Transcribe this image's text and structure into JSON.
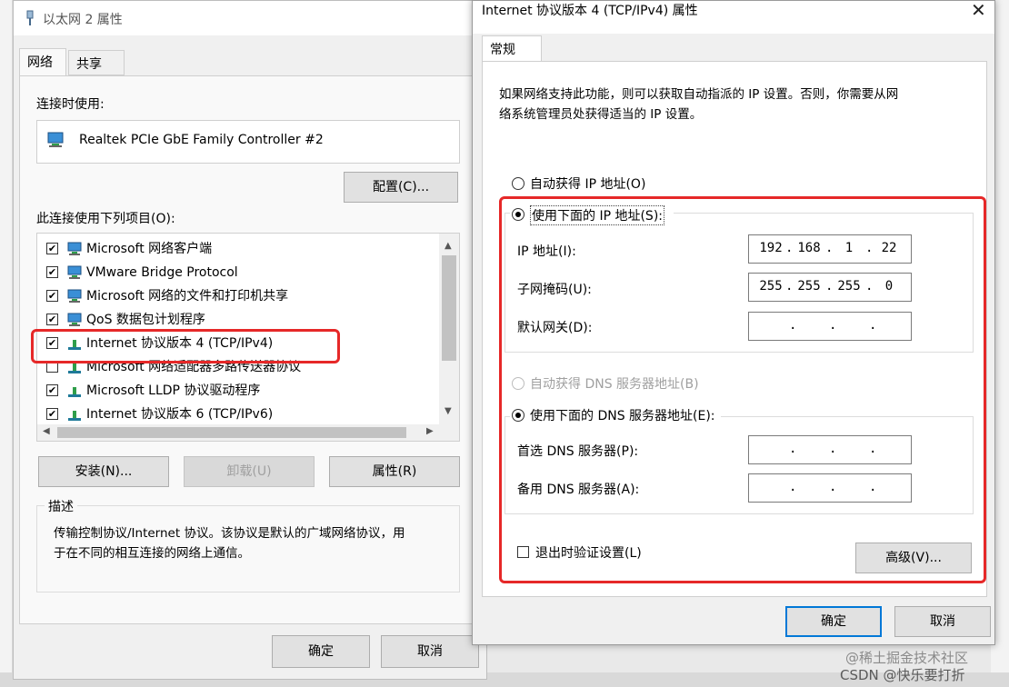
{
  "dialog1": {
    "title": "以太网 2 属性",
    "tabs": [
      "网络",
      "共享"
    ],
    "connect_using_label": "连接时使用:",
    "adapter_name": "Realtek PCIe GbE Family Controller #2",
    "configure_button": "配置(C)...",
    "items_label": "此连接使用下列项目(O):",
    "items": [
      {
        "label": "Microsoft 网络客户端",
        "checked": true
      },
      {
        "label": "VMware Bridge Protocol",
        "checked": true
      },
      {
        "label": "Microsoft 网络的文件和打印机共享",
        "checked": true
      },
      {
        "label": "QoS 数据包计划程序",
        "checked": true
      },
      {
        "label": "Internet 协议版本 4 (TCP/IPv4)",
        "checked": true
      },
      {
        "label": "Microsoft 网络适配器多路传送器协议",
        "checked": false
      },
      {
        "label": "Microsoft LLDP 协议驱动程序",
        "checked": true
      },
      {
        "label": "Internet 协议版本 6 (TCP/IPv6)",
        "checked": true
      }
    ],
    "install_button": "安装(N)...",
    "uninstall_button": "卸载(U)",
    "properties_button": "属性(R)",
    "description_label": "描述",
    "description_text_1": "传输控制协议/Internet 协议。该协议是默认的广域网络协议，用",
    "description_text_2": "于在不同的相互连接的网络上通信。",
    "ok_button": "确定",
    "cancel_button": "取消"
  },
  "dialog2": {
    "title": "Internet 协议版本 4 (TCP/IPv4) 属性",
    "tab": "常规",
    "intro_1": "如果网络支持此功能，则可以获取自动指派的 IP 设置。否则，你需要从网",
    "intro_2": "络系统管理员处获得适当的 IP 设置。",
    "auto_ip_label": "自动获得 IP 地址(O)",
    "manual_ip_label": "使用下面的 IP 地址(S):",
    "ip_label": "IP 地址(I):",
    "ip_octets": [
      "192",
      "168",
      "1",
      "22"
    ],
    "mask_label": "子网掩码(U):",
    "mask_octets": [
      "255",
      "255",
      "255",
      "0"
    ],
    "gateway_label": "默认网关(D):",
    "gateway_octets": [
      "",
      "",
      "",
      ""
    ],
    "auto_dns_label": "自动获得 DNS 服务器地址(B)",
    "manual_dns_label": "使用下面的 DNS 服务器地址(E):",
    "preferred_dns_label": "首选 DNS 服务器(P):",
    "preferred_dns_octets": [
      "",
      "",
      "",
      ""
    ],
    "alternate_dns_label": "备用 DNS 服务器(A):",
    "alternate_dns_octets": [
      "",
      "",
      "",
      ""
    ],
    "validate_label": "退出时验证设置(L)",
    "advanced_button": "高级(V)...",
    "ok_button": "确定",
    "cancel_button": "取消"
  },
  "watermark": {
    "line1": "@稀土掘金技术社区",
    "line2": "CSDN @快乐要打折"
  },
  "colors": {
    "highlight_red": "#e62828",
    "focus_blue": "#0078d7"
  }
}
